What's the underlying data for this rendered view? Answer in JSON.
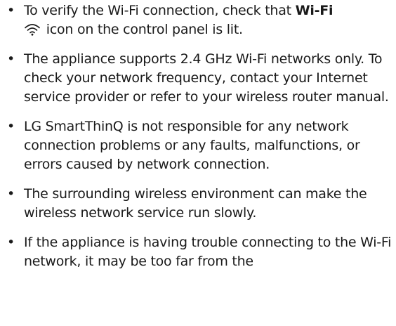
{
  "notes": [
    {
      "before": "To verify the Wi-Fi connection, check that ",
      "bold": "Wi-Fi",
      "after": " icon on the control panel is lit.",
      "icon": "wifi-icon"
    },
    {
      "text": "The appliance supports 2.4 GHz Wi-Fi networks only. To check your network frequency, contact your Internet service provider or refer to your wireless router manual."
    },
    {
      "text": "LG SmartThinQ is not responsible for any network connection problems or any faults, malfunctions, or errors caused by network connection."
    },
    {
      "text": "The surrounding wireless environment can make the wireless network service run slowly."
    },
    {
      "text": "If the appliance is having trouble connecting to the Wi-Fi network, it may be too far from the"
    }
  ],
  "bullet_char": "•",
  "colors": {
    "text": "#1a1a1a",
    "background": "#ffffff"
  }
}
